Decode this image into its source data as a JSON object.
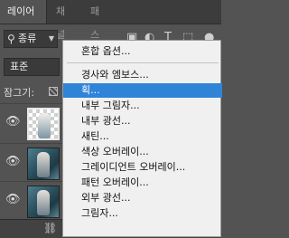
{
  "tabs": [
    {
      "label": "레이어",
      "active": true
    },
    {
      "label": "채널",
      "active": false
    },
    {
      "label": "패스",
      "active": false
    }
  ],
  "tab_close_glyph": "×",
  "filter": {
    "label": "종류",
    "icon": "search-icon",
    "dropdown_icon": "chevron-down-icon"
  },
  "blend_mode": {
    "value": "표준"
  },
  "lock_label": "잠그기:",
  "menu": {
    "items": [
      {
        "label": "혼합 옵션...",
        "highlighted": false
      },
      {
        "label": "경사와 엠보스...",
        "highlighted": false
      },
      {
        "label": "획...",
        "highlighted": true
      },
      {
        "label": "내부 그림자...",
        "highlighted": false
      },
      {
        "label": "내부 광선...",
        "highlighted": false
      },
      {
        "label": "새틴...",
        "highlighted": false
      },
      {
        "label": "색상 오버레이...",
        "highlighted": false
      },
      {
        "label": "그레이디언트 오버레이...",
        "highlighted": false
      },
      {
        "label": "패턴 오버레이...",
        "highlighted": false
      },
      {
        "label": "외부 광선...",
        "highlighted": false
      },
      {
        "label": "그림자...",
        "highlighted": false
      }
    ]
  },
  "colors": {
    "highlight": "#2f84d8",
    "panel_bg": "#535353",
    "menu_bg": "#f0f0f0"
  }
}
